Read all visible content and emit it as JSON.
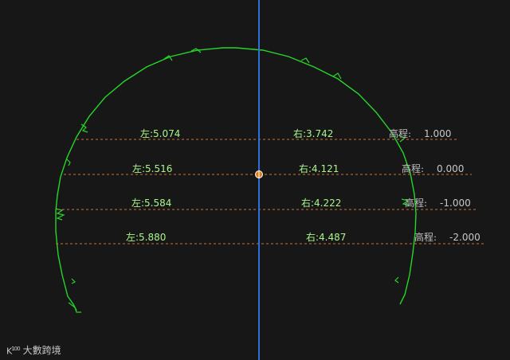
{
  "colors": {
    "background": "#171717",
    "profile": "#25d62a",
    "center_line": "#2f6fd6",
    "guide_line": "#c8743b",
    "label_text": "#a9f58b",
    "elevation_text": "#bfbfbf",
    "center_marker": "#e07a1f"
  },
  "rows": [
    {
      "left": "左:5.074",
      "right": "右:3.742",
      "elevation_label": "高程:",
      "elevation_value": "1.000"
    },
    {
      "left": "左:5.516",
      "right": "右:4.121",
      "elevation_label": "高程:",
      "elevation_value": "0.000"
    },
    {
      "left": "左:5.584",
      "right": "右:4.222",
      "elevation_label": "高程:",
      "elevation_value": "-1.000"
    },
    {
      "left": "左:5.880",
      "right": "右:4.487",
      "elevation_label": "高程:",
      "elevation_value": "-2.000"
    }
  ],
  "watermark": {
    "logo": "K",
    "logo_sup": "100",
    "text": "大數跨境",
    "icon": "brand-logo-icon"
  }
}
